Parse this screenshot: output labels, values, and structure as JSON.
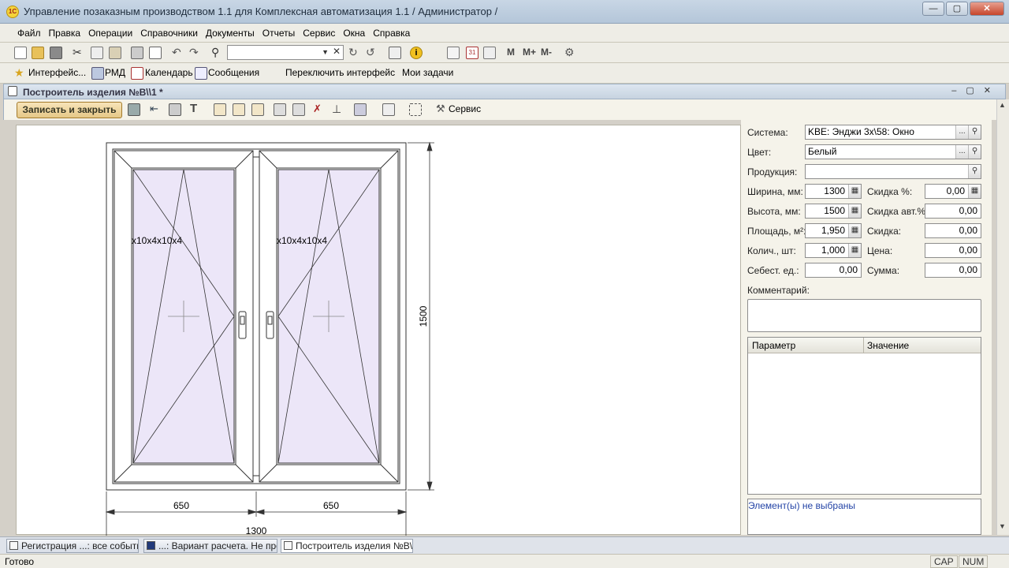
{
  "window": {
    "title": "Управление позаказным производством 1.1 для Комплексная автоматизация 1.1 / Администратор /"
  },
  "menu": [
    "Файл",
    "Правка",
    "Операции",
    "Справочники",
    "Документы",
    "Отчеты",
    "Сервис",
    "Окна",
    "Справка"
  ],
  "toolbar2": {
    "interfaces": "Интерфейс...",
    "rmd": "РМД",
    "calendar": "Календарь",
    "messages": "Сообщения",
    "switch_interface": "Переключить интерфейс",
    "my_tasks": "Мои задачи",
    "m1": "M",
    "m2": "M+",
    "m3": "M-"
  },
  "doc": {
    "title": "Построитель изделия №В\\\\1 *",
    "save_close": "Записать и закрыть",
    "service": "Сервис"
  },
  "drawing": {
    "glass_left": "x10x4x10x4",
    "glass_right": "x10x4x10x4",
    "dim_left": "650",
    "dim_right": "650",
    "dim_total": "1300",
    "dim_height": "1500",
    "glass_color": "#ece6f8"
  },
  "form": {
    "system_label": "Система:",
    "system_value": "KBE: Энджи 3х\\58: Окно",
    "color_label": "Цвет:",
    "color_value": "Белый",
    "product_label": "Продукция:",
    "product_value": "",
    "width_label": "Ширина, мм:",
    "width_value": "1300",
    "discount_pct_label": "Скидка %:",
    "discount_pct_value": "0,00",
    "height_label": "Высота, мм:",
    "height_value": "1500",
    "discount_auto_label": "Скидка авт.%:",
    "discount_auto_value": "0,00",
    "area_label": "Площадь, м²:",
    "area_value": "1,950",
    "discount_label": "Скидка:",
    "discount_value": "0,00",
    "qty_label": "Колич., шт:",
    "qty_value": "1,000",
    "price_label": "Цена:",
    "price_value": "0,00",
    "cost_label": "Себест. ед.:",
    "cost_value": "0,00",
    "sum_label": "Сумма:",
    "sum_value": "0,00",
    "comment_label": "Комментарий:",
    "col_param": "Параметр",
    "col_value": "Значение",
    "selection_status": "Элемент(ы) не выбраны"
  },
  "taskbar": [
    {
      "label": "Регистрация ...: все события"
    },
    {
      "label": "...: Вариант расчета. Не про..."
    },
    {
      "label": "Построитель изделия №В\\..."
    }
  ],
  "statusbar": {
    "ready": "Готово",
    "cap": "CAP",
    "num": "NUM"
  },
  "icons": [
    "app-1c-icon",
    "new-icon",
    "open-icon",
    "save-icon",
    "cut-icon",
    "copy-icon",
    "paste-icon",
    "print-icon",
    "preview-icon",
    "undo-icon",
    "redo-icon",
    "find-icon",
    "info-icon",
    "calculator-icon",
    "calendar-icon",
    "tools-icon"
  ]
}
